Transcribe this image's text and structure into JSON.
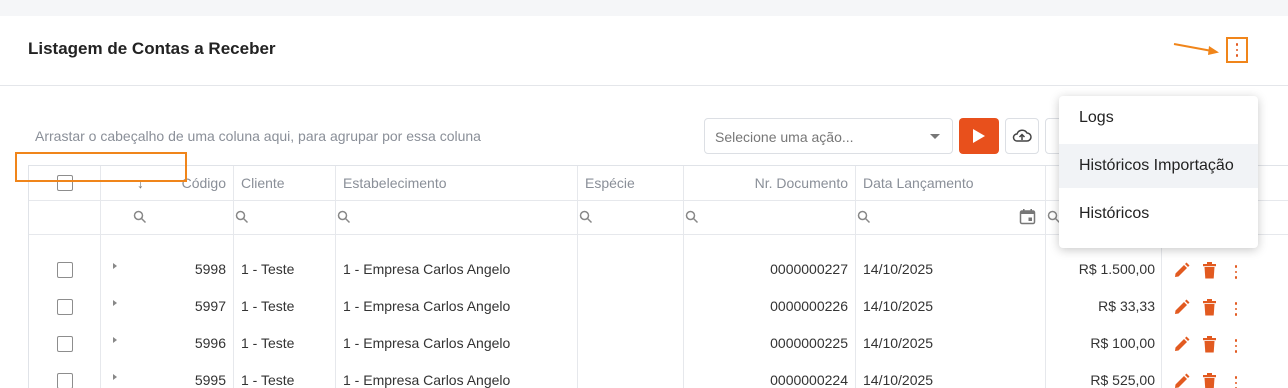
{
  "header": {
    "title": "Listagem de Contas a Receber"
  },
  "toolbar": {
    "group_hint": "Arrastar o cabeçalho de uma coluna aqui, para agrupar por essa coluna",
    "action_select_placeholder": "Selecione uma ação..."
  },
  "table": {
    "columns": {
      "sort_arrow": "↓",
      "codigo": "Código",
      "cliente": "Cliente",
      "estabelecimento": "Estabelecimento",
      "especie": "Espécie",
      "nr_documento": "Nr. Documento",
      "data_lancamento": "Data Lançamento"
    },
    "rows": [
      {
        "codigo": "5998",
        "cliente": "1 - Teste",
        "estabelecimento": "1 - Empresa Carlos Angelo",
        "especie": "",
        "nr_documento": "0000000227",
        "data_lancamento": "14/10/2025",
        "valor": "R$ 1.500,00"
      },
      {
        "codigo": "5997",
        "cliente": "1 - Teste",
        "estabelecimento": "1 - Empresa Carlos Angelo",
        "especie": "",
        "nr_documento": "0000000226",
        "data_lancamento": "14/10/2025",
        "valor": "R$ 33,33"
      },
      {
        "codigo": "5996",
        "cliente": "1 - Teste",
        "estabelecimento": "1 - Empresa Carlos Angelo",
        "especie": "",
        "nr_documento": "0000000225",
        "data_lancamento": "14/10/2025",
        "valor": "R$ 100,00"
      },
      {
        "codigo": "5995",
        "cliente": "1 - Teste",
        "estabelecimento": "1 - Empresa Carlos Angelo",
        "especie": "",
        "nr_documento": "0000000224",
        "data_lancamento": "14/10/2025",
        "valor": "R$ 525,00"
      }
    ]
  },
  "menu": {
    "items": [
      {
        "label": "Logs"
      },
      {
        "label": "Históricos Importação",
        "highlighted": true
      },
      {
        "label": "Históricos"
      }
    ]
  },
  "colors": {
    "accent": "#e8501c",
    "highlight": "#f0851a",
    "action_icon": "#e25a20"
  },
  "icons": [
    "kebab-icon",
    "annotation-arrow-icon",
    "play-icon",
    "cloud-upload-icon",
    "search-icon",
    "calendar-icon",
    "edit-icon",
    "trash-icon",
    "expand-icon"
  ]
}
